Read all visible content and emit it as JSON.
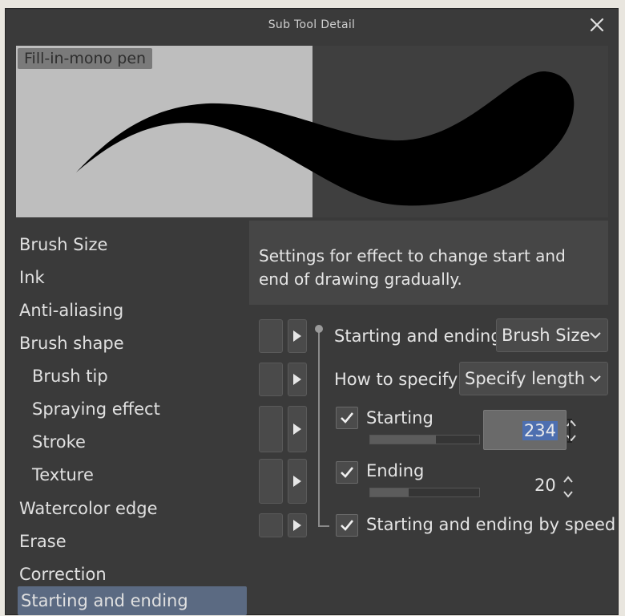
{
  "window": {
    "title": "Sub Tool Detail"
  },
  "preview": {
    "label": "Fill-in-mono pen"
  },
  "categories": [
    {
      "label": "Brush Size",
      "sub": false
    },
    {
      "label": "Ink",
      "sub": false
    },
    {
      "label": "Anti-aliasing",
      "sub": false
    },
    {
      "label": "Brush shape",
      "sub": false
    },
    {
      "label": "Brush tip",
      "sub": true
    },
    {
      "label": "Spraying effect",
      "sub": true
    },
    {
      "label": "Stroke",
      "sub": true
    },
    {
      "label": "Texture",
      "sub": true
    },
    {
      "label": "Watercolor edge",
      "sub": false
    },
    {
      "label": "Erase",
      "sub": false
    },
    {
      "label": "Correction",
      "sub": false
    },
    {
      "label": "Starting and ending",
      "sub": false,
      "selected": true
    }
  ],
  "description": "Settings for effect to change start and end of drawing gradually.",
  "settings": {
    "starting_and_ending": {
      "label": "Starting and ending",
      "value": "Brush Size"
    },
    "how_to_specify": {
      "label": "How to specify",
      "value": "Specify length"
    },
    "starting": {
      "label": "Starting",
      "checked": true,
      "value": "234",
      "slider_fraction": 0.6
    },
    "ending": {
      "label": "Ending",
      "checked": true,
      "value": "20",
      "slider_fraction": 0.35
    },
    "by_speed": {
      "label": "Starting and ending by speed",
      "checked": true
    }
  },
  "colors": {
    "selection": "#5b6a82",
    "text_highlight": "#4d6fb0",
    "window_bg": "#3a3a3a"
  },
  "icons": {
    "close": "close-icon",
    "expand": "triangle-right-icon",
    "check": "checkmark-icon",
    "dropdown": "chevron-down-icon",
    "spinner": "spinner-icon"
  }
}
